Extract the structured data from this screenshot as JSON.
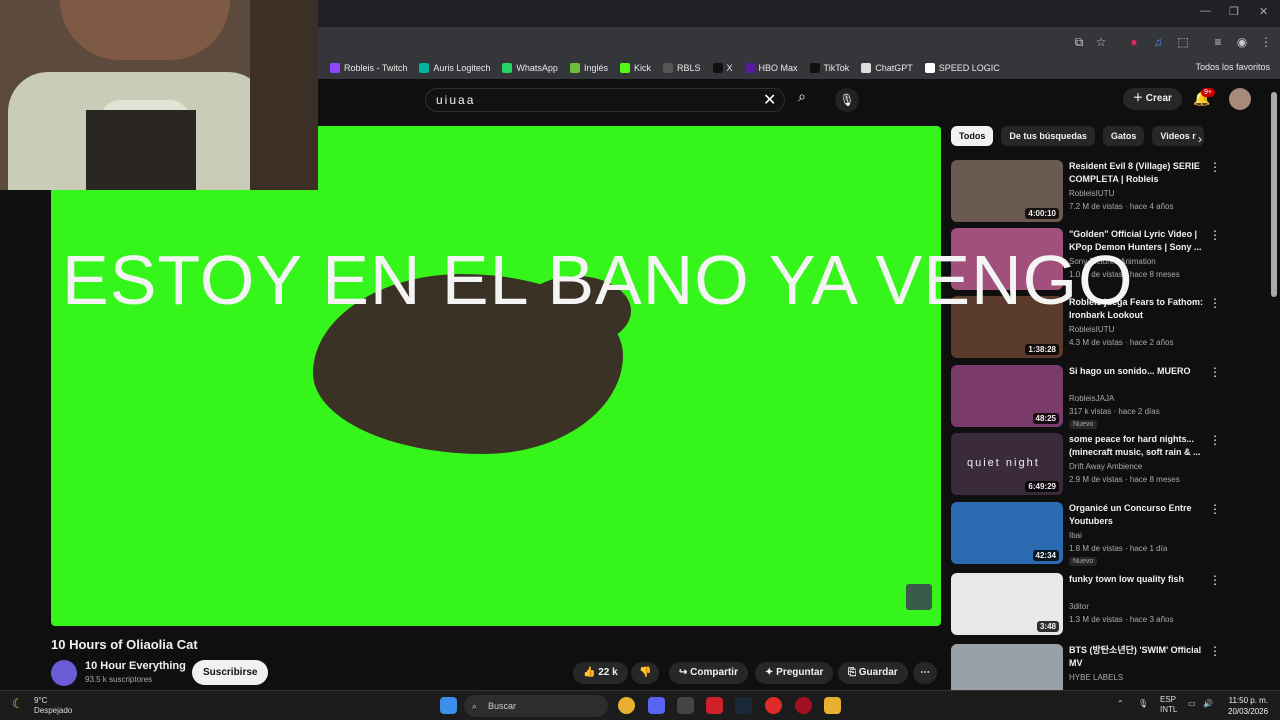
{
  "window": {
    "min": "—",
    "max": "❐",
    "close": "✕"
  },
  "bookmarks": [
    "Robleis - Twitch",
    "Auris Logitech",
    "WhatsApp",
    "Inglés",
    "Kick",
    "RBLS",
    "X",
    "HBO Max",
    "TikTok",
    "ChatGPT",
    "SPEED LOGIC"
  ],
  "bookmarks_all": "Todos los favoritos",
  "search": {
    "value": "uiuaa"
  },
  "header": {
    "create_label": "Crear",
    "notif_badge": "9+"
  },
  "overlay_text": "ESTOY EN EL BANO YA VENGO",
  "video": {
    "title": "10 Hours of Oliaolia Cat",
    "channel": "10 Hour Everything",
    "subscribers": "93.5 k suscriptores",
    "subscribe_label": "Suscribirse",
    "likes": "22 k",
    "share": "Compartir",
    "ask": "Preguntar",
    "save": "Guardar"
  },
  "chips": [
    "Todos",
    "De tus búsquedas",
    "Gatos",
    "Videos r"
  ],
  "recommendations": [
    {
      "title": "Resident Evil 8 (Village) SERIE COMPLETA | Robleis",
      "channel": "RobleisIUTU",
      "meta": "7.2 M de vistas · hace 4 años",
      "duration": "4:00:10",
      "color": "#6b5a52"
    },
    {
      "title": "\"Golden\" Official Lyric Video | KPop Demon Hunters | Sony ...",
      "channel": "Sony Pictures Animation",
      "meta": "1.0 M de vistas · hace 8 meses",
      "duration": "",
      "color": "#a0507a"
    },
    {
      "title": "Robleis juega Fears to Fathom: Ironbark Lookout",
      "channel": "RobleisIUTU",
      "meta": "4.3 M de vistas · hace 2 años",
      "duration": "1:38:28",
      "color": "#5a3a2a"
    },
    {
      "title": "Si hago un sonido... MUERO",
      "channel": "RobleisJAJA",
      "meta": "317 k vistas · hace 2 días",
      "duration": "48:25",
      "badge": "Nuevo",
      "color": "#7a3a6a"
    },
    {
      "title": "some peace for hard nights... (minecraft music, soft rain & ...",
      "channel": "Drift Away Ambience",
      "meta": "2.9 M de vistas · hace 8 meses",
      "duration": "6:49:29",
      "color": "#3a2a3a",
      "thumb_text": "quiet night"
    },
    {
      "title": "Organicé un Concurso Entre Youtubers",
      "channel": "Ibai",
      "meta": "1.8 M de vistas · hace 1 día",
      "duration": "42:34",
      "badge": "Nuevo",
      "color": "#2a6ab0"
    },
    {
      "title": "funky town low quality fish",
      "channel": "3ditor",
      "meta": "1.3 M de vistas · hace 3 años",
      "duration": "3:48",
      "color": "#e8e8e8"
    },
    {
      "title": "BTS (방탄소년단) 'SWIM' Official MV",
      "channel": "HYBE LABELS",
      "meta": "",
      "duration": "",
      "color": "#9aa0a8"
    }
  ],
  "taskbar": {
    "temp": "9°C",
    "weather": "Despejado",
    "search": "Buscar",
    "lang1": "ESP",
    "lang2": "INTL",
    "time": "11:50 p. m.",
    "date": "20/03/2026"
  },
  "colors": {
    "player_bg": "#35f51b",
    "bg": "#0f0f0f"
  }
}
